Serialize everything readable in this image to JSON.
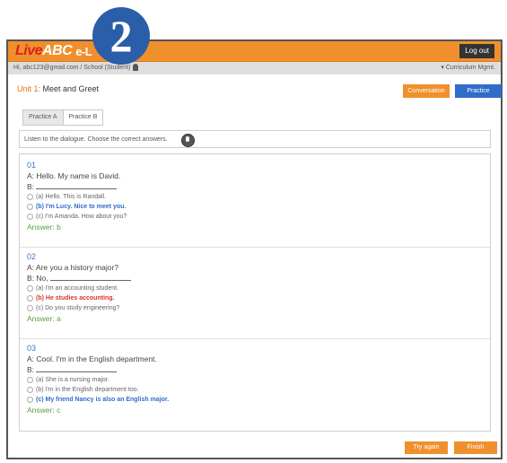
{
  "badge": "2",
  "header": {
    "logo_live": "Live",
    "logo_abc": "ABC",
    "logo_sub": "e-L",
    "logout_label": "Log out"
  },
  "userbar": {
    "user_text": "Hi, abc123@gmail.com / School (Student)",
    "mgmt_text": "▾ Curriculum Mgmt."
  },
  "unit": {
    "label": "Unit 1:",
    "title": " Meet and Greet"
  },
  "buttons": {
    "conversation": "Conversation",
    "practice": "Practice",
    "try_again": "Try again",
    "finish": "Finish"
  },
  "tabs": [
    "Practice A",
    "Practice B"
  ],
  "instruction": "Listen to the dialogue. Choose the correct answers.",
  "questions": [
    {
      "number": "01",
      "prompt": "A: Hello. My name is David.",
      "b_line": "B:",
      "options": [
        "(a) Hello. This is Randall.",
        "(b) I'm Lucy. Nice to meet you.",
        "(c) I'm Amanda. How about you?"
      ],
      "answer": "Answer: b"
    },
    {
      "number": "02",
      "prompt": "A: Are you a history major?",
      "b_line": "B: No,",
      "options": [
        "(a) I'm an accounting student.",
        "(b) He studies accounting.",
        "(c) Do you study engineering?"
      ],
      "answer": "Answer: a"
    },
    {
      "number": "03",
      "prompt": "A: Cool. I'm in the English department.",
      "b_line": "B:",
      "options": [
        "(a) She is a nursing major.",
        "(b) I'm in the English department too.",
        "(c) My friend Nancy is also an English major."
      ],
      "answer": "Answer: c"
    }
  ]
}
